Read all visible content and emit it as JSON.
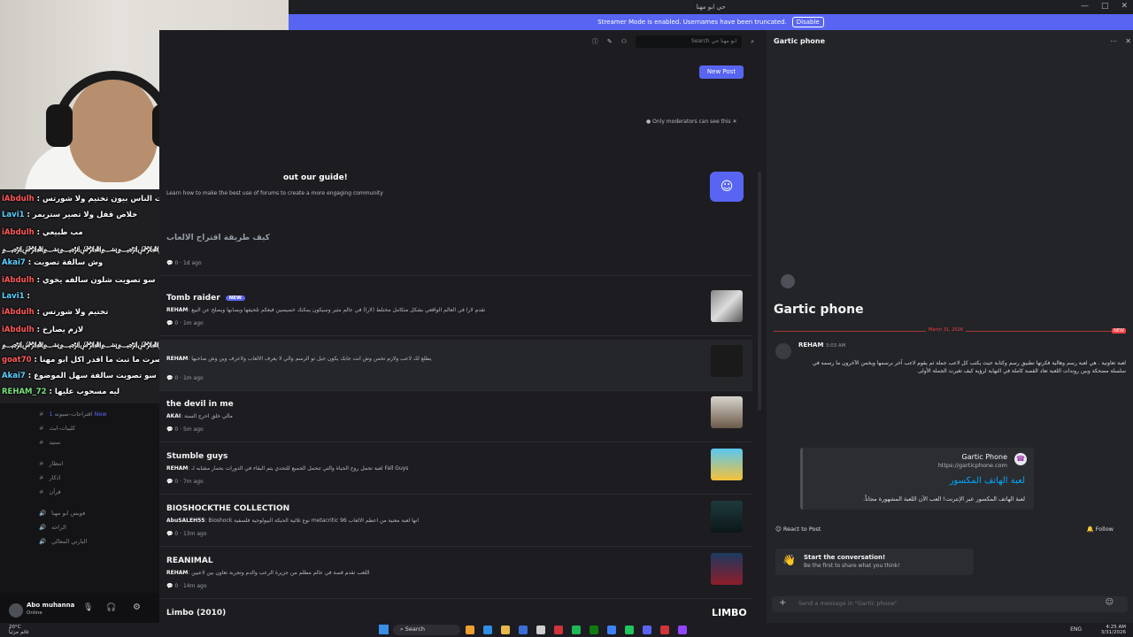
{
  "window": {
    "title": "حي ابو مهنا",
    "controls": [
      "—",
      "□",
      "✕"
    ]
  },
  "streamer_banner": {
    "text": "Streamer Mode is enabled. Usernames have been truncated.",
    "button": "Disable"
  },
  "stream_chat": [
    {
      "user": "iAbdulh",
      "text": "لا سو تصويت الناس بيون تختيم ولا شورتس"
    },
    {
      "user": "Lavi1",
      "text": "خلاص قفل ولا تصير ستريمر"
    },
    {
      "user": "iAbdulh",
      "text": "مب طبيعي"
    },
    {
      "user": "",
      "text": "﷽﷽﷽﷽﷽﷽﷽﷽﷽﷽﷽﷽﷽﷽"
    },
    {
      "user": "Akai7",
      "text": "وش سالفة تصويت"
    },
    {
      "user": "iAbdulh",
      "text": "سو تصويت شلون سالفه يخوي"
    },
    {
      "user": "Lavi1",
      "text": ""
    },
    {
      "user": "iAbdulh",
      "text": "تختيم ولا شورتس"
    },
    {
      "user": "iAbdulh",
      "text": "لازم يصارخ"
    },
    {
      "user": "",
      "text": "﷽﷽﷽﷽﷽﷽﷽﷽﷽﷽﷽﷽﷽﷽"
    },
    {
      "user": "goat70",
      "text": "اذ صرت ما تبث ما اقدر اكل ابو مهنا"
    },
    {
      "user": "Akai7",
      "text": "يب سو تصويت سالفة سهل الموضوع"
    },
    {
      "user": "REHAM_72",
      "text": "ليه مسحوب عليها"
    }
  ],
  "sidebar": {
    "channels": [
      {
        "label": "ﺍﻗﺘﺮﺍﺣﺎﺕ-ﺳﺒﻮﻧﻪ",
        "badge": "1 New"
      },
      {
        "label": "ﻛﻠﻴﺒﺎﺕ-ﺍﺑﺚ"
      },
      {
        "label": "ﺳﺘﻴﺪ"
      },
      {
        "label": "ﺍﻧﺘﻈﺎﺭ"
      },
      {
        "label": "ﺍﺫﻛﺎﺭ"
      },
      {
        "label": "ﻗﺮﺁﻥ"
      },
      {
        "label": "ﻓﻮﻳﺲ ﺍﺑﻮ ﻣﻬﻨﺎ"
      },
      {
        "label": "ﺍﻟﺮﺍﺣﻪ"
      },
      {
        "label": "ﺍﻟﺒﺎﺭﺗﻲ ﺍﻟﻤﻌﺎﻟﻲ"
      }
    ],
    "user": {
      "name": "Abo muhanna",
      "status": "Online"
    }
  },
  "forum": {
    "search_placeholder": "Search ابو مهنا حي",
    "new_post": "New Post",
    "mod_note": "Only moderators can see this",
    "guide_title": "out our guide!",
    "guide_sub": "Learn how to make the best use of forums to create a more engaging community",
    "posts": [
      {
        "title": "كيف طريقة اقتراح الالعاب",
        "author": "",
        "excerpt": "",
        "replies": "0",
        "time": "1d ago",
        "badge": ""
      },
      {
        "title": "Tomb raider",
        "badge": "NEW",
        "author": "REHAM",
        "excerpt": "تقدم لارا في العالم الواقعي بشكل متكامل مختلط (لارا) في عالم مثير وسيكون يمكنك خصيصين فيعكم تلحيفها ويصابها ويصلح عن البيع",
        "replies": "0",
        "time": "1m ago"
      },
      {
        "title": "",
        "badge": "",
        "author": "REHAM",
        "excerpt": "يطلع لك لاعب ولازم تخمن وش انت جابك يكون جيل تو الرسم والي لا يعرف الالعاب ولاعرف وين وش صاحبها",
        "replies": "0",
        "time": "1m ago"
      },
      {
        "title": "the devil in me",
        "badge": "",
        "author": "AKAI",
        "excerpt": "مالي خلق احرج السنة",
        "replies": "0",
        "time": "5m ago"
      },
      {
        "title": "Stumble guys",
        "badge": "",
        "author": "REHAM",
        "excerpt": "لعبة تحمل روح الحياة والتي تتحمل الجميع للتحدي يتم البقاء في الدورات بحمار مشابه لـ Fall Guys",
        "replies": "0",
        "time": "7m ago"
      },
      {
        "title": "BIOSHOCKTHE COLLECTION",
        "badge": "",
        "author": "AbuSALEH55",
        "excerpt": "Bioshock نوع ثلاثية الحبكة البيولوجية فلسفية metacritic 96 انها لعبة معنية من اعظم الالعاب",
        "replies": "0",
        "time": "13m ago"
      },
      {
        "title": "REANIMAL",
        "badge": "",
        "author": "REHAM",
        "excerpt": "اللعب تقدم قصة في عالم مظلم من جزيرة الرعب والدم وتجربة تعاون بين لاعبين",
        "replies": "0",
        "time": "14m ago"
      },
      {
        "title": "Limbo (2010)",
        "badge": "",
        "author": "",
        "excerpt": "",
        "replies": "",
        "time": ""
      }
    ]
  },
  "thread": {
    "header": "Gartic phone",
    "title": "Gartic phone",
    "date": "March 31, 2026",
    "new_label": "NEW",
    "author": "REHAM",
    "time": "3:03 AM",
    "message": "لعبة تعاونية . هي لعبة رسم وهالية فكرتها تطبيق رسم وكتابة حيث يكتب كل لاعب جملة ثم يقوم لاعب آخر برسمها ويخمن الآخرون ما رسمه في سلسلة مضحكة وبين روندات اللعبة تعاد القصة كاملة في النهاية لرؤية كيف تغيرت الجملة الأولى",
    "embed": {
      "name": "Gartic Phone",
      "url": "https://garticphone.com",
      "title": "لعبة الهاتف المكسور",
      "desc": "لعبة الهاتف المكسور عبر الإنترنت! العب الآن اللعبة المشهورة مجاناً."
    },
    "react": "React to Post",
    "follow": "Follow",
    "start_title": "Start the conversation!",
    "start_sub": "Be the first to share what you think!",
    "composer_placeholder": "Send a message in \"Gartic phone\""
  },
  "taskbar": {
    "weather_temp": "20°C",
    "weather_desc": "غائم جزئياً",
    "search": "Search",
    "lang": "ENG",
    "time": "4:25 AM",
    "date": "3/31/2026"
  },
  "colors": {
    "accent": "#5865f2",
    "danger": "#f23f42",
    "bg": "#1d1d21",
    "panel": "#232428"
  }
}
